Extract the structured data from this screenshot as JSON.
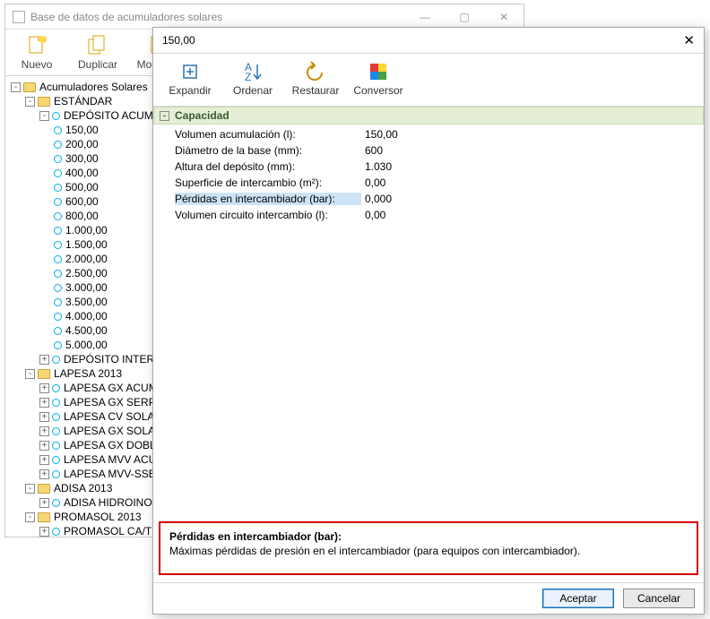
{
  "back_window": {
    "title": "Base de datos de acumuladores solares",
    "toolbar": {
      "nuevo": "Nuevo",
      "duplicar": "Duplicar",
      "modificar": "Modificar"
    },
    "tree": {
      "root": "Acumuladores Solares",
      "estandar": "ESTÁNDAR",
      "deposito_acum": "DEPÓSITO ACUM",
      "caps": [
        "150,00",
        "200,00",
        "300,00",
        "400,00",
        "500,00",
        "600,00",
        "800,00",
        "1.000,00",
        "1.500,00",
        "2.000,00",
        "2.500,00",
        "3.000,00",
        "3.500,00",
        "4.000,00",
        "4.500,00",
        "5.000,00"
      ],
      "deposito_inter": "DEPÓSITO INTER",
      "lapesa": "LAPESA 2013",
      "lapesa_items": [
        "LAPESA GX ACUM",
        "LAPESA GX SERP",
        "LAPESA CV SOLA",
        "LAPESA GX SOLA",
        "LAPESA GX DOBL",
        "LAPESA MVV ACU",
        "LAPESA MVV-SSB"
      ],
      "adisa": "ADISA 2013",
      "adisa_items": [
        "ADISA HIDROINO"
      ],
      "promasol": "PROMASOL 2013",
      "promasol_items": [
        "PROMASOL CA/T"
      ]
    }
  },
  "front_window": {
    "title": "150,00",
    "toolbar": {
      "expandir": "Expandir",
      "ordenar": "Ordenar",
      "restaurar": "Restaurar",
      "conversor": "Conversor"
    },
    "group": "Capacidad",
    "props": [
      {
        "name": "Volumen acumulación (l):",
        "value": "150,00"
      },
      {
        "name": "Diámetro de la base (mm):",
        "value": "600"
      },
      {
        "name": "Altura del depósito (mm):",
        "value": "1.030"
      },
      {
        "name": "Superficie de intercambio (m²):",
        "value": "0,00"
      },
      {
        "name": "Pérdidas en intercambiador (bar):",
        "value": "0,000"
      },
      {
        "name": "Volumen circuito intercambio (l):",
        "value": "0,00"
      }
    ],
    "info": {
      "title": "Pérdidas en intercambiador (bar):",
      "desc": "Máximas pérdidas de presión en el intercambiador (para equipos con intercambiador)."
    },
    "buttons": {
      "ok": "Aceptar",
      "cancel": "Cancelar"
    }
  }
}
